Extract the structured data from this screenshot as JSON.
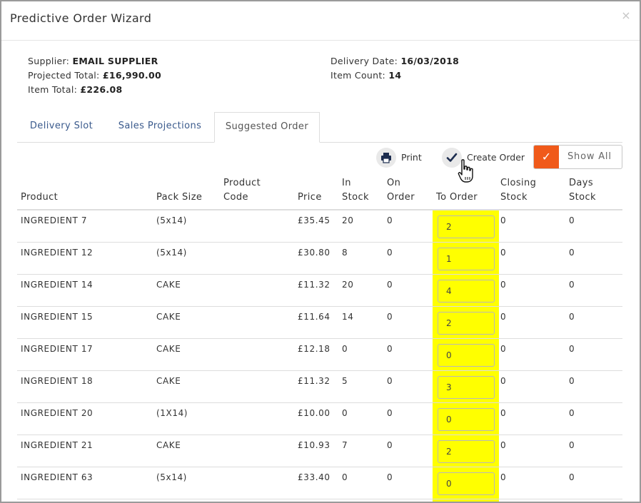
{
  "modal": {
    "title": "Predictive Order Wizard",
    "close_glyph": "×"
  },
  "summary": {
    "supplier_label": "Supplier:",
    "supplier_value": "EMAIL SUPPLIER",
    "projected_total_label": "Projected Total:",
    "projected_total_value": "£16,990.00",
    "item_total_label": "Item Total:",
    "item_total_value": "£226.08",
    "delivery_date_label": "Delivery Date:",
    "delivery_date_value": "16/03/2018",
    "item_count_label": "Item Count:",
    "item_count_value": "14"
  },
  "tabs": [
    {
      "label": "Delivery Slot",
      "active": false
    },
    {
      "label": "Sales Projections",
      "active": false
    },
    {
      "label": "Suggested Order",
      "active": true
    }
  ],
  "toolbar": {
    "print_label": "Print",
    "create_order_label": "Create Order",
    "show_all_label": "Show All",
    "show_all_checked": true,
    "accent_color": "#f05a1a"
  },
  "table": {
    "headers": {
      "product": "Product",
      "pack_size": "Pack Size",
      "product_code_1": "Product",
      "product_code_2": "Code",
      "price": "Price",
      "in_stock_1": "In",
      "in_stock_2": "Stock",
      "on_order_1": "On",
      "on_order_2": "Order",
      "to_order": "To Order",
      "closing_stock_1": "Closing",
      "closing_stock_2": "Stock",
      "days_stock_1": "Days",
      "days_stock_2": "Stock"
    },
    "highlight_color": "#ffff00",
    "rows": [
      {
        "product": "INGREDIENT 7",
        "pack_size": "(5x14)",
        "product_code": "",
        "price": "£35.45",
        "in_stock": "20",
        "on_order": "0",
        "to_order": "2",
        "closing_stock": "0",
        "days_stock": "0"
      },
      {
        "product": "INGREDIENT 12",
        "pack_size": "(5x14)",
        "product_code": "",
        "price": "£30.80",
        "in_stock": "8",
        "on_order": "0",
        "to_order": "1",
        "closing_stock": "0",
        "days_stock": "0"
      },
      {
        "product": "INGREDIENT 14",
        "pack_size": "CAKE",
        "product_code": "",
        "price": "£11.32",
        "in_stock": "20",
        "on_order": "0",
        "to_order": "4",
        "closing_stock": "0",
        "days_stock": "0"
      },
      {
        "product": "INGREDIENT 15",
        "pack_size": "CAKE",
        "product_code": "",
        "price": "£11.64",
        "in_stock": "14",
        "on_order": "0",
        "to_order": "2",
        "closing_stock": "0",
        "days_stock": "0"
      },
      {
        "product": "INGREDIENT 17",
        "pack_size": "CAKE",
        "product_code": "",
        "price": "£12.18",
        "in_stock": "0",
        "on_order": "0",
        "to_order": "0",
        "closing_stock": "0",
        "days_stock": "0"
      },
      {
        "product": "INGREDIENT 18",
        "pack_size": "CAKE",
        "product_code": "",
        "price": "£11.32",
        "in_stock": "5",
        "on_order": "0",
        "to_order": "3",
        "closing_stock": "0",
        "days_stock": "0"
      },
      {
        "product": "INGREDIENT 20",
        "pack_size": "(1X14)",
        "product_code": "",
        "price": "£10.00",
        "in_stock": "0",
        "on_order": "0",
        "to_order": "0",
        "closing_stock": "0",
        "days_stock": "0"
      },
      {
        "product": "INGREDIENT 21",
        "pack_size": "CAKE",
        "product_code": "",
        "price": "£10.93",
        "in_stock": "7",
        "on_order": "0",
        "to_order": "2",
        "closing_stock": "0",
        "days_stock": "0"
      },
      {
        "product": "INGREDIENT 63",
        "pack_size": "(5x14)",
        "product_code": "",
        "price": "£33.40",
        "in_stock": "0",
        "on_order": "0",
        "to_order": "0",
        "closing_stock": "0",
        "days_stock": "0"
      }
    ]
  }
}
